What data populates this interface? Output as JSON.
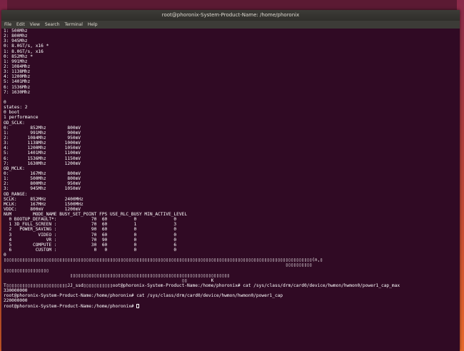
{
  "window": {
    "title": "root@phoronix-System-Product-Name: /home/phoronix"
  },
  "menu": [
    "File",
    "Edit",
    "View",
    "Search",
    "Terminal",
    "Help"
  ],
  "terminal_lines": [
    "1: 500Mhz",
    "2: 800Mhz",
    "3: 945Mhz",
    "0: 8.0GT/s, x16 *",
    "1: 8.0GT/s, x16",
    "0: 852Mhz *",
    "1: 991Mhz",
    "2: 1084Mhz",
    "3: 1138Mhz",
    "4: 1200Mhz",
    "5: 1401Mhz",
    "6: 1536Mhz",
    "7: 1630Mhz",
    "",
    "0",
    "states: 2",
    "0 boot",
    "1 performance",
    "OD_SCLK:",
    "0:        852Mhz        800mV",
    "1:        991Mhz        900mV",
    "2:       1084Mhz        950mV",
    "3:       1138Mhz       1000mV",
    "4:       1200Mhz       1050mV",
    "5:       1401Mhz       1100mV",
    "6:       1536Mhz       1150mV",
    "7:       1630Mhz       1200mV",
    "OD_MCLK:",
    "0:        167Mhz        800mV",
    "1:        500Mhz        800mV",
    "2:        800Mhz        950mV",
    "3:        945Mhz       1050mV",
    "OD_RANGE:",
    "SCLK:     852MHz       2400MHz",
    "MCLK:     167MHz       1500MHz",
    "VDDC:     800mV        1200mV",
    "NUM        MODE_NAME BUSY_SET_POINT FPS USE_RLC_BUSY MIN_ACTIVE_LEVEL",
    "  0 BOOTUP_DEFAULT*:             70  60          0              0",
    "  1 3D_FULL_SCREEN :             70  60          1              3",
    "  2   POWER_SAVING :             90  60          0              0",
    "  3          VIDEO :             70  60          0              0",
    "  4             VR :             70  90          0              0",
    "  5        COMPUTE :             30  60          0              6",
    "  6         CUSTOM :              0   0          0              0",
    "0",
    "▯▯▯▯▯▯▯▯▯▯▯▯▯▯▯▯▯▯▯▯▯▯▯▯▯▯▯▯▯▯▯▯▯▯▯▯▯▯▯▯▯▯▯▯▯▯▯▯▯▯▯▯▯▯▯▯▯▯▯▯▯▯▯▯▯▯▯▯▯▯▯▯▯▯▯▯▯▯▯▯▯▯▯▯▯▯▯▯▯▯▯▯▯▯▯▯▯▯▯▯▯▯▯▯▯▯▯▯▯▯▯▯▯▯▯▯(n,▯",
    "                                                                                                          ▯▯▯▯▯▯▯▯▯▯",
    "▯▯▯▯▯▯▯▯▯▯▯▯▯▯▯▯▯",
    "                         ▯▯▯▯▯▯▯▯▯▯▯▯▯▯▯▯▯▯▯▯▯▯▯▯▯▯▯▯▯▯▯▯▯▯▯▯▯▯▯▯▯▯▯▯▯▯▯▯▯▯▯▯▯▯▯▯▯▯▯▯",
    "                                                                   ▯▯         K",
    "T▯▯▯▯▯▯▯▯▯▯▯▯▯▯▯▯▯▯▯▯▯▯▯JJ_ssd▯▯▯▯▯▯▯▯▯▯▯oot@phoronix-System-Product-Name:/home/phoronix# cat /sys/class/drm/card0/device/hwmon/hwmon0/power1_cap_max",
    "330000000",
    "root@phoronix-System-Product-Name:/home/phoronix# cat /sys/class/drm/card0/device/hwmon/hwmon0/power1_cap",
    "220000000",
    "root@phoronix-System-Product-Name:/home/phoronix# "
  ]
}
